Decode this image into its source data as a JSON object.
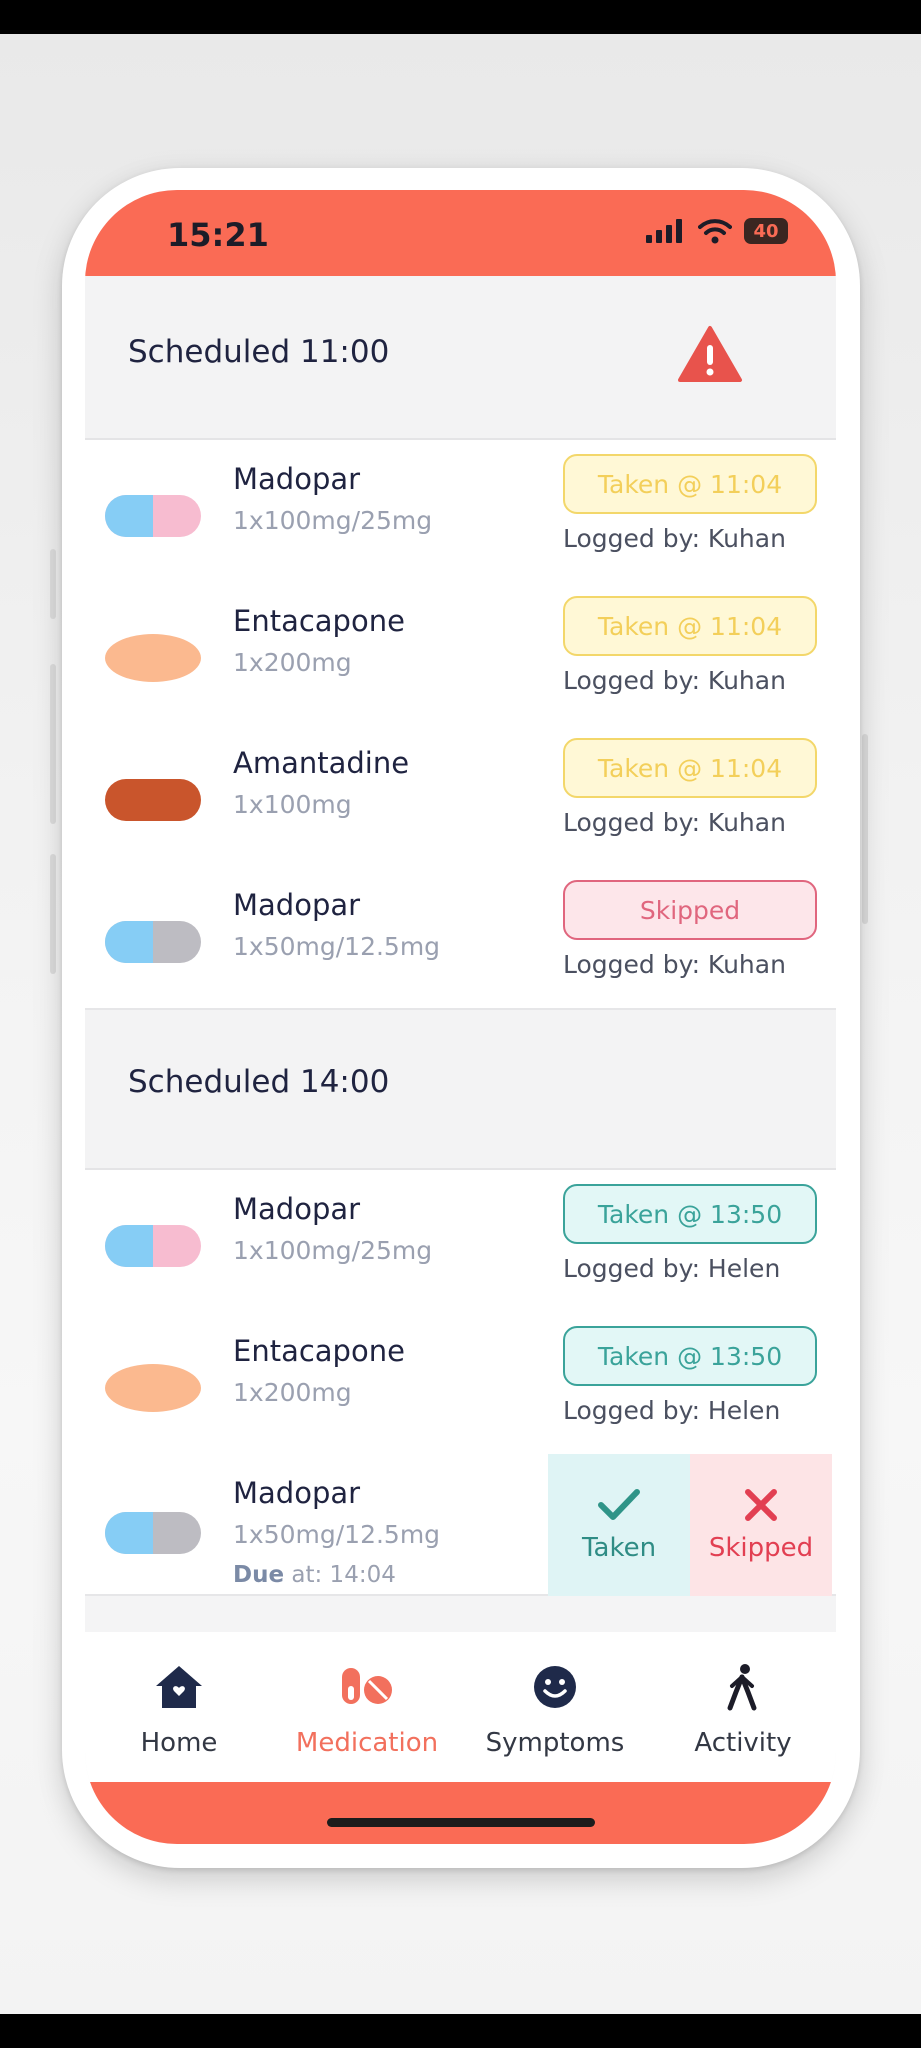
{
  "status": {
    "time": "15:21",
    "battery": "40"
  },
  "sections": [
    {
      "title": "Scheduled 11:00",
      "warning_icon": "warning-triangle-icon",
      "items": [
        {
          "name": "Madopar",
          "dose": "1x100mg/25mg",
          "status": "Taken @ 11:04",
          "logged": "Logged by: Kuhan",
          "pill": "capsule-blue-pink"
        },
        {
          "name": "Entacapone",
          "dose": "1x200mg",
          "status": "Taken @ 11:04",
          "logged": "Logged by: Kuhan",
          "pill": "oval-peach"
        },
        {
          "name": "Amantadine",
          "dose": "1x100mg",
          "status": "Taken @ 11:04",
          "logged": "Logged by: Kuhan",
          "pill": "capsule-rust"
        },
        {
          "name": "Madopar",
          "dose": "1x50mg/12.5mg",
          "status": "Skipped",
          "logged": "Logged by: Kuhan",
          "pill": "capsule-blue-grey"
        }
      ]
    },
    {
      "title": "Scheduled 14:00",
      "items": [
        {
          "name": "Madopar",
          "dose": "1x100mg/25mg",
          "status": "Taken @ 13:50",
          "logged": "Logged by: Helen",
          "pill": "capsule-blue-pink"
        },
        {
          "name": "Entacapone",
          "dose": "1x200mg",
          "status": "Taken @ 13:50",
          "logged": "Logged by: Helen",
          "pill": "oval-peach"
        },
        {
          "name": "Madopar",
          "dose": "1x50mg/12.5mg",
          "due_label": "Due",
          "due_time": " at: 14:04",
          "pill": "capsule-blue-grey",
          "actions": {
            "taken": "Taken",
            "skipped": "Skipped"
          }
        }
      ]
    }
  ],
  "tabs": [
    {
      "label": "Home",
      "icon": "home-icon"
    },
    {
      "label": "Medication",
      "icon": "pills-icon",
      "active": true
    },
    {
      "label": "Symptoms",
      "icon": "smiley-icon"
    },
    {
      "label": "Activity",
      "icon": "walking-icon"
    }
  ],
  "colors": {
    "brand": "#fa6b55",
    "taken_yellow": "#f3cf5a",
    "skipped_red": "#e0667e",
    "taken_teal": "#3aa39a"
  }
}
